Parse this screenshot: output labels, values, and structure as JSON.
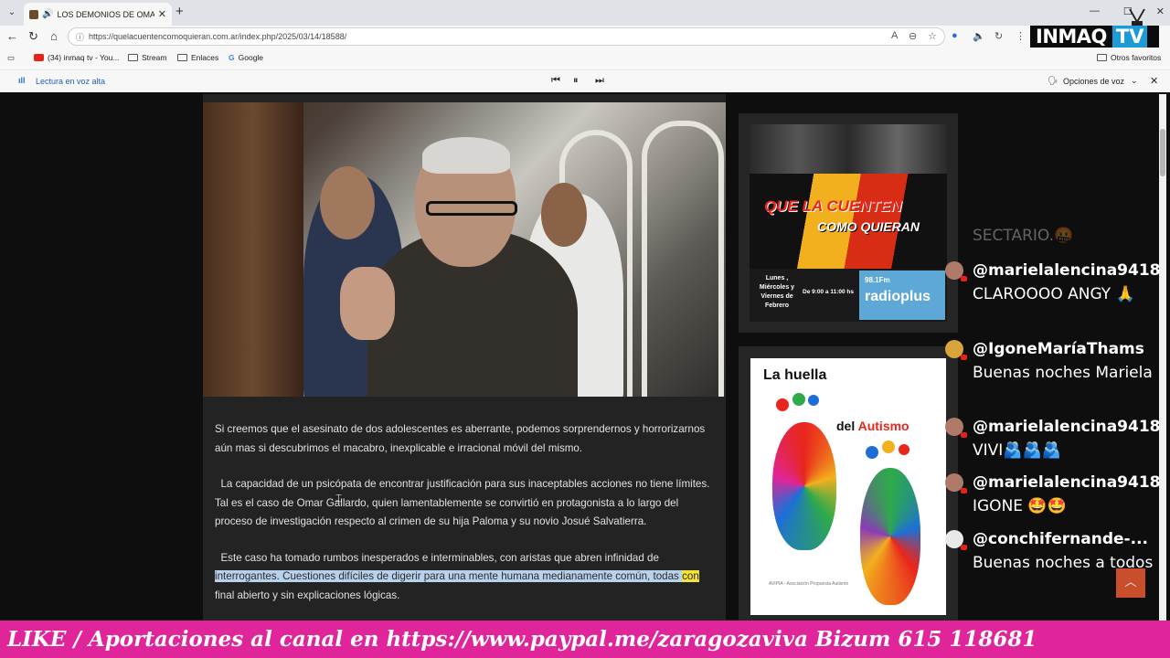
{
  "browser": {
    "tab_title": "LOS DEMONIOS DE OMAR G...",
    "url": "https://quelacuentencomoquieran.com.ar/index.php/2025/03/14/18588/",
    "bookmarks": [
      "(34) inmaq tv - You...",
      "Stream",
      "Enlaces",
      "Google"
    ],
    "other_favorites": "Otros favoritos"
  },
  "readaloud": {
    "label": "Lectura en voz alta",
    "options": "Opciones de voz"
  },
  "logo": {
    "part1": "INMAQ",
    "part2": "TV"
  },
  "article": {
    "p1": "Si creemos que el asesinato de dos adolescentes es aberrante, podemos sorprendernos y horrorizarnos aún mas si descubrimos el macabro, inexplicable e irracional móvil del mismo.",
    "p2": "La capacidad de un psicópata de encontrar justificación para sus inaceptables acciones no tiene límites. Tal es el caso de Omar Gallardo, quien lamentablemente se convirtió en protagonista a lo largo del proceso de investigación respecto al crimen de su hija Paloma y su novio Josué Salvatierra.",
    "p3_start": "Este caso ha tomado rumbos inesperados e interminables, con aristas que abren infinidad de ",
    "p3_highlight": "interrogantes. Cuestiones difíciles de digerir para una mente humana medianamente común, todas ",
    "p3_current": "con",
    "p3_end": " final abierto y sin explicaciones lógicas."
  },
  "ad1": {
    "brand_line1": "QUE LA CUENTEN",
    "brand_line2": "COMO QUIERAN",
    "days": "Lunes , Miércoles y Viernes de Febrero",
    "hours": "De 9:00 a 11:00 hs",
    "radio_freq": "98.1Fm",
    "radio_name": "radioplus"
  },
  "ad2": {
    "title": "La huella",
    "subtitle_a": "del ",
    "subtitle_b": "Autismo",
    "footer": "AVIPIA - Asociación Propuesta Autismo"
  },
  "chat": [
    {
      "user": "",
      "text": "SECTARIO.🤬",
      "faded": true
    },
    {
      "user": "@marielalencina9418",
      "text": "CLAROOOO ANGY 🙏"
    },
    {
      "user": "@IgoneMaríaThams",
      "text": "Buenas noches Mariela"
    },
    {
      "user": "@marielalencina9418",
      "text": "VIVI🫂🫂🫂"
    },
    {
      "user": "@marielalencina9418",
      "text": "IGONE 🤩🤩"
    },
    {
      "user": "@conchifernande-...",
      "text": "Buenas noches a todos"
    }
  ],
  "banner": "LIKE / Aportaciones al canal en https://www.paypal.me/zaragozaviva Bizum 615 118681",
  "colors": {
    "banner": "#e0259a",
    "logo_tv": "#1d9bd7",
    "highlight": "#b8d2ee",
    "current_word": "#f5e33a"
  }
}
